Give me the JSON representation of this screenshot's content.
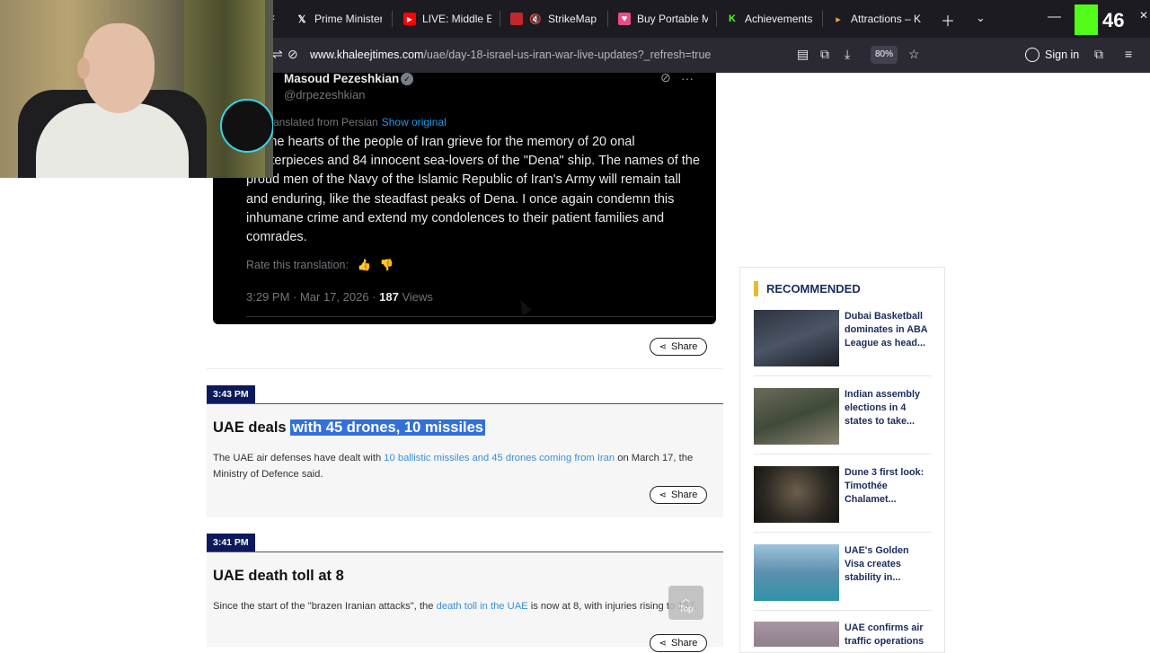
{
  "browser": {
    "tabs": [
      {
        "label": "Prime Minister",
        "icon": "x-logo-icon"
      },
      {
        "label": "LIVE: Middle Ea",
        "icon": "youtube-icon"
      },
      {
        "label": "StrikeMap",
        "icon": "mute-icon"
      },
      {
        "label": "Buy Portable M",
        "icon": "shop-icon"
      },
      {
        "label": "Achievements",
        "icon": "kick-icon"
      },
      {
        "label": "Attractions – K",
        "icon": "pin-icon"
      }
    ],
    "url_host": "www.khaleejtimes.com",
    "url_path": "/uae/day-18-israel-us-iran-war-live-updates?_refresh=true",
    "zoom": "80%",
    "sign_in": "Sign in",
    "badge_number": "46"
  },
  "tweet": {
    "author": "Masoud Pezeshkian",
    "handle": "@drpezeshkian",
    "translated_from": "anslated from Persian",
    "show_original": "Show original",
    "body": "ay, the hearts of the people of Iran grieve for the memory of 20 onal masterpieces and 84 innocent sea-lovers of the \"Dena\" ship. The names of the proud men of the Navy of the Islamic Republic of Iran's Army will remain tall and enduring, like the steadfast peaks of Dena. I once again condemn this inhumane crime and extend my condolences to their patient families and comrades.",
    "rate_label": "Rate this translation:",
    "time": "3:29 PM · Mar 17, 2026 · ",
    "views_count": "187",
    "views_label": " Views"
  },
  "posts": [
    {
      "time": "3:43 PM",
      "title_plain": "UAE deals ",
      "title_highlight": "with 45 drones, 10 missiles",
      "text_before": "The UAE air defenses have dealt with ",
      "text_link": "10 ballistic missiles and 45 drones coming from Iran",
      "text_after": " on March 17, the Ministry of Defence said."
    },
    {
      "time": "3:41 PM",
      "title_plain": "UAE death toll at 8",
      "text_before": "Since the start of the \"brazen Iranian attacks\", the ",
      "text_link": "death toll in the UAE",
      "text_after": " is now at 8, with injuries rising to 157."
    }
  ],
  "share_label": "Share",
  "top_label": "Top",
  "sidebar": {
    "title": "RECOMMENDED",
    "items": [
      {
        "label": "Dubai Basketball dominates in ABA League as head...",
        "thumb": "#3a3f4a"
      },
      {
        "label": "Indian assembly elections in 4 states to take...",
        "thumb": "#5a5b4e"
      },
      {
        "label": "Dune 3 first look: Timothée Chalamet...",
        "thumb": "#3b3a33"
      },
      {
        "label": "UAE's Golden Visa creates stability in...",
        "thumb": "#4c86a8"
      },
      {
        "label": "UAE confirms air traffic operations",
        "thumb": "#8a7a86"
      }
    ]
  }
}
